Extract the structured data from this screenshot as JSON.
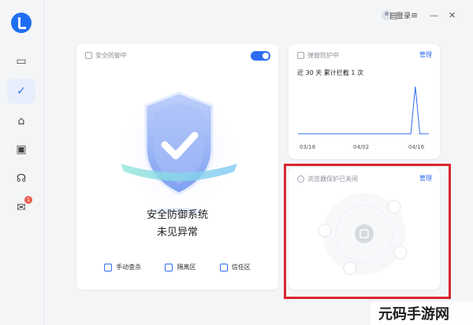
{
  "sidebar": {
    "items": [
      {
        "name": "computer",
        "glyph": "▭"
      },
      {
        "name": "protection",
        "glyph": "✓"
      },
      {
        "name": "clean",
        "glyph": "⌂"
      },
      {
        "name": "toolbox",
        "glyph": "▣"
      },
      {
        "name": "support",
        "glyph": "☊"
      },
      {
        "name": "messages",
        "glyph": "✉",
        "badge": "1"
      }
    ]
  },
  "topbar": {
    "login_label": "登录",
    "icons": {
      "skin": "▤",
      "menu": "≡",
      "minimize": "—",
      "close": "✕"
    }
  },
  "security_card": {
    "title": "安全防御中",
    "toggle_on": true,
    "status_line1": "安全防御系统",
    "status_line2": "未见异常",
    "tools": [
      {
        "label": "手动查杀"
      },
      {
        "label": "隔离区"
      },
      {
        "label": "信任区"
      }
    ]
  },
  "popup_card": {
    "title": "弹窗防护中",
    "manage_label": "管理",
    "stat_text": "近 30 天 累计拦截 1 次",
    "chart_data": {
      "type": "line",
      "x": [
        "03/18",
        "04/02",
        "04/16"
      ],
      "title": "",
      "xlabel": "",
      "ylabel": "",
      "series": [
        {
          "values": [
            0,
            0,
            0,
            0,
            0,
            0,
            0,
            0,
            0,
            0,
            0,
            0,
            0,
            0,
            0,
            0,
            0,
            0,
            0,
            0,
            0,
            0,
            0,
            0,
            0,
            0,
            1,
            0,
            0,
            0
          ]
        }
      ],
      "ylim": [
        0,
        1
      ]
    }
  },
  "browser_card": {
    "title": "浏览器保护已关闭",
    "manage_label": "管理"
  },
  "watermark": {
    "text": "元码手游网"
  },
  "colors": {
    "accent": "#2d6cf0",
    "highlight": "#d9262e",
    "badge": "#ef5a4a"
  }
}
